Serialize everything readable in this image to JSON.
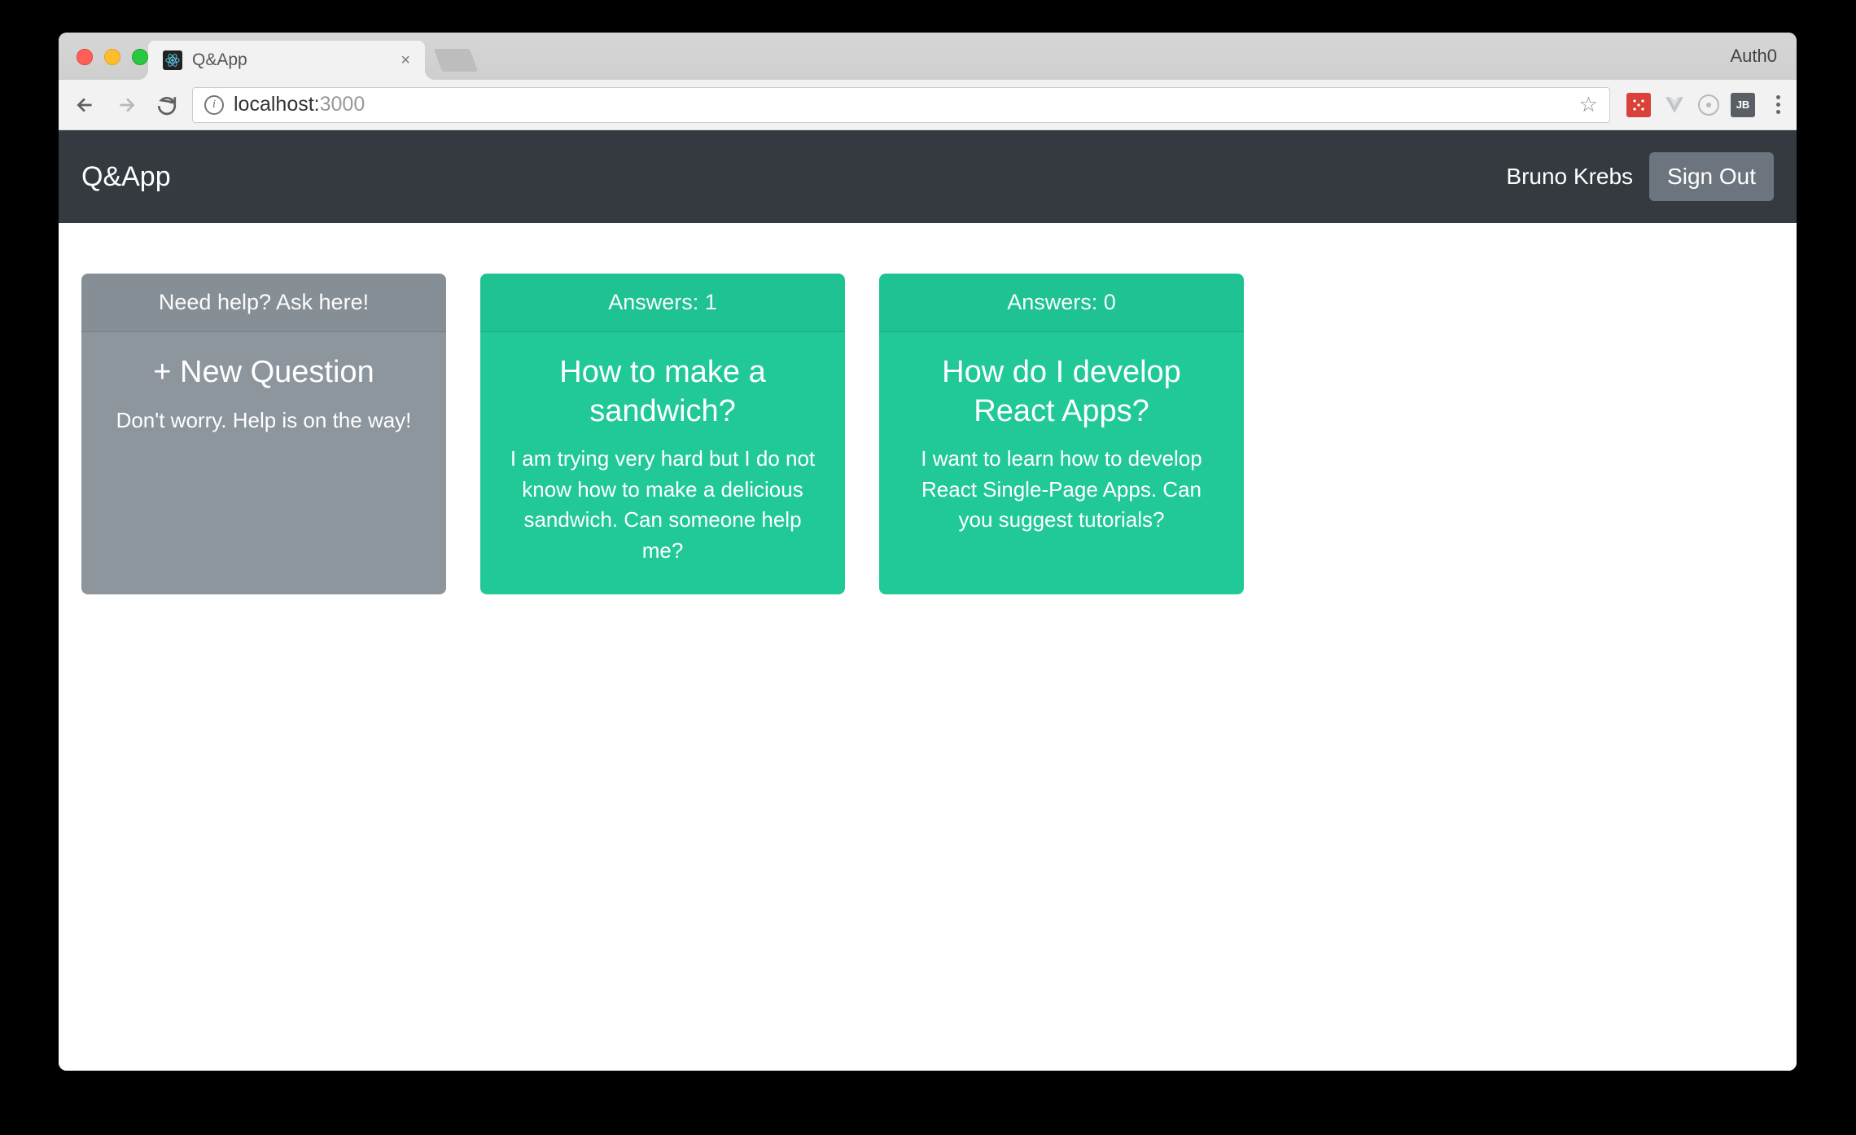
{
  "browser": {
    "tab_title": "Q&App",
    "profile": "Auth0",
    "url_host": "localhost:",
    "url_port": "3000"
  },
  "navbar": {
    "brand": "Q&App",
    "user": "Bruno Krebs",
    "signout": "Sign Out"
  },
  "new_question": {
    "header": "Need help? Ask here!",
    "title": "+ New Question",
    "text": "Don't worry. Help is on the way!"
  },
  "questions": [
    {
      "answers_label": "Answers: 1",
      "title": "How to make a sandwich?",
      "text": "I am trying very hard but I do not know how to make a delicious sandwich. Can someone help me?"
    },
    {
      "answers_label": "Answers: 0",
      "title": "How do I develop React Apps?",
      "text": "I want to learn how to develop React Single-Page Apps. Can you suggest tutorials?"
    }
  ]
}
